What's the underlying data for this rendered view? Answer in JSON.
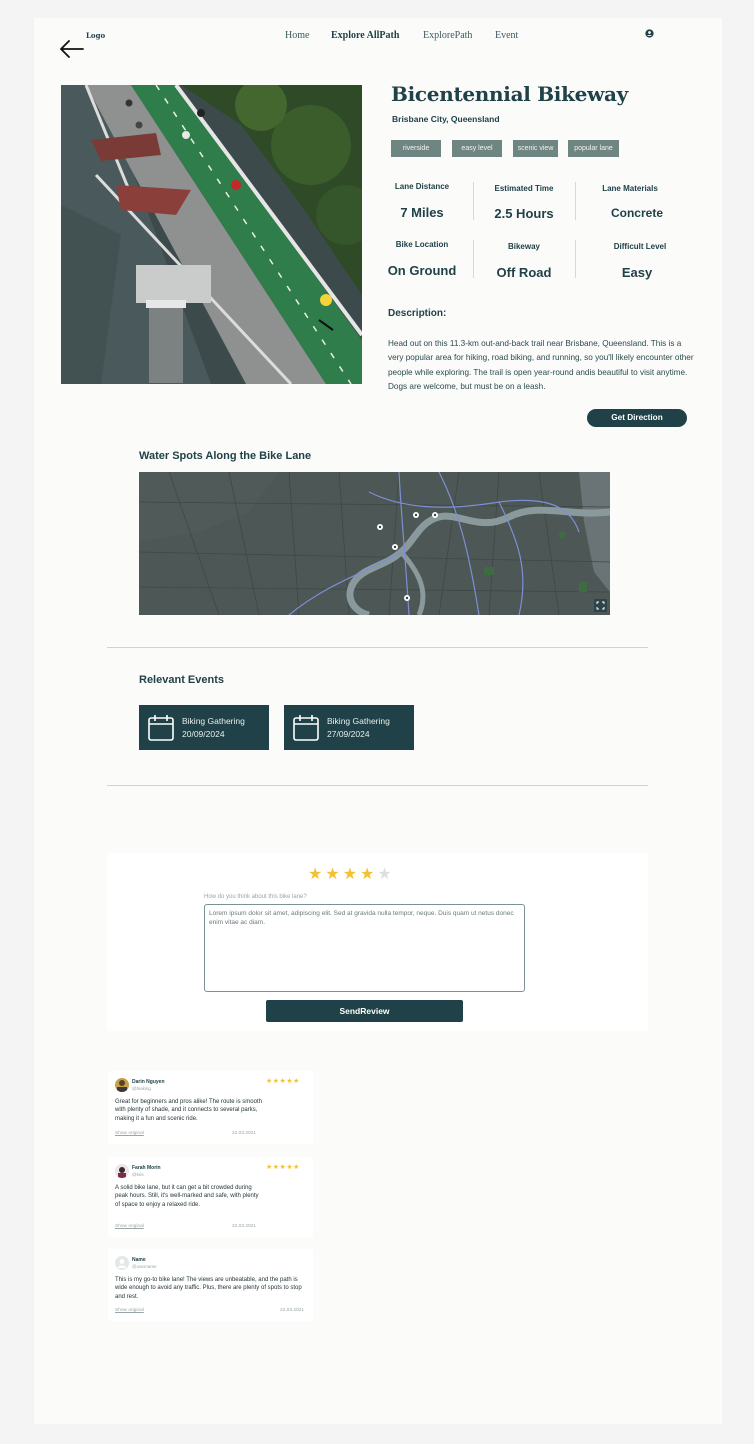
{
  "header": {
    "logo": "Logo",
    "nav": [
      "Home",
      "Explore AllPath",
      "ExplorePath",
      "Event"
    ]
  },
  "trail": {
    "title": "Bicentennial Bikeway",
    "location": "Brisbane City, Queensland",
    "tags": [
      "riverside",
      "easy level",
      "scenic view",
      "popular lane"
    ],
    "stats": [
      {
        "label": "Lane Distance",
        "value": "7 Miles"
      },
      {
        "label": "Estimated Time",
        "value": "2.5 Hours"
      },
      {
        "label": "Lane Materials",
        "value": "Concrete"
      },
      {
        "label": "Bike Location",
        "value": "On Ground"
      },
      {
        "label": "Bikeway",
        "value": "Off Road"
      },
      {
        "label": "Difficult Level",
        "value": "Easy"
      }
    ],
    "description_heading": "Description:",
    "description": "Head out on this 11.3-km out-and-back trail near Brisbane, Queensland. This is a very popular area for hiking, road biking, and running, so you'll likely encounter other people while exploring. The trail is open year-round andis beautiful to visit anytime. Dogs are welcome, but must be on a leash.",
    "direction_button": "Get Direction"
  },
  "water_spots": {
    "heading": "Water Spots Along the Bike Lane"
  },
  "events": {
    "heading": "Relevant Events",
    "items": [
      {
        "name": "Biking Gathering",
        "date": "20/09/2024"
      },
      {
        "name": "Biking Gathering",
        "date": "27/09/2024"
      }
    ]
  },
  "review_form": {
    "rating": 4,
    "max_rating": 5,
    "question": "How do you think about this bike lane?",
    "text": "Lorem ipsum dolor sit amet,  adipiscing elit. Sed at gravida nulla tempor, neque. Duis quam ut netus donec enim vitae ac diam.",
    "submit": "SendReview"
  },
  "reviews": [
    {
      "name": "Darin Nguyen",
      "handle": "@biaking",
      "stars": "★★★★★",
      "text": "Great for beginners and pros alike! The route is smooth with plenty of shade, and it connects to several parks, making it a fun and scenic ride.",
      "show": "Show original",
      "date": "22.03.2021"
    },
    {
      "name": "Farah Morin",
      "handle": "@kris",
      "stars": "★★★★★",
      "text": "A solid bike lane, but it can get a bit crowded during peak hours. Still, it's well-marked and safe, with plenty of space to enjoy a relaxed ride.",
      "show": "Show original",
      "date": "22.03.2021"
    },
    {
      "name": "Name",
      "handle": "@username",
      "stars": "",
      "text": "This is my go-to bike lane! The views are unbeatable, and the path is wide enough to avoid any traffic. Plus, there are plenty of spots to stop and rest.",
      "show": "Show original",
      "date": "22.03.2021"
    }
  ],
  "colors": {
    "brand": "#1f4147",
    "tag": "#6f8582",
    "star": "#f2c233",
    "background": "#f4f4f4"
  }
}
